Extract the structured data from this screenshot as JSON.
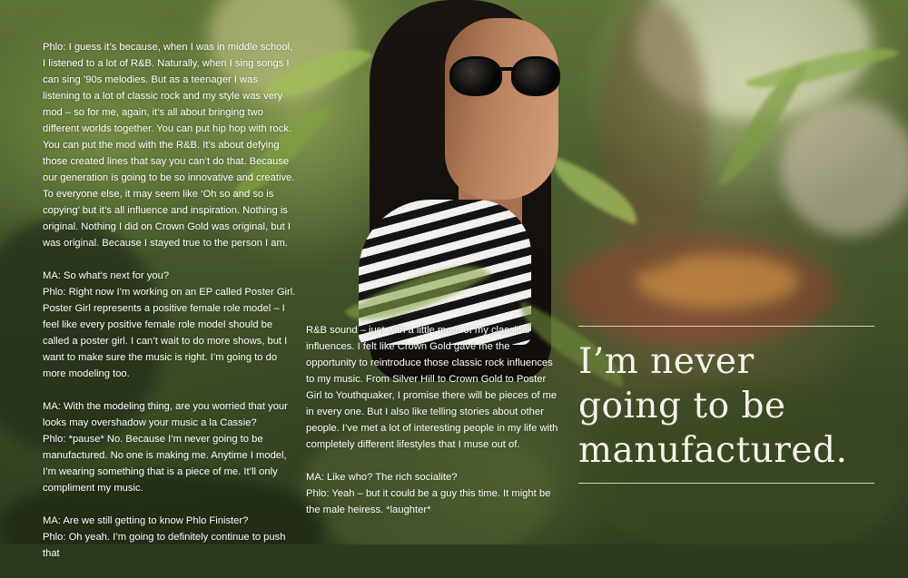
{
  "article": {
    "left_column": [
      "Phlo: I guess it’s because, when I was in middle school, I listened to a lot of R&B. Naturally, when I sing songs I can sing ’90s melodies. But as a teenager I was listening to a lot of classic rock and my style was very mod – so for me, again, it’s all about bringing two different worlds together. You can put hip hop with rock. You can put the mod with the R&B. It’s about defying those created lines that say you can’t do that. Because our generation is going to be so innovative and creative. To everyone else, it may seem like ‘Oh so and so is copying’ but it’s all influence and inspiration. Nothing is original. Nothing I did on Crown Gold was original, but I was original. Because I stayed true to the person I am.",
      "MA: So what’s next for you?\nPhlo: Right now I’m working on an EP called Poster Girl. Poster Girl represents a positive female role model – I feel like every positive female role model should be called a poster girl. I can’t wait to do more shows, but I want to make sure the music is right. I’m going to do more modeling too.",
      "MA: With the modeling thing, are you worried that your looks may overshadow your music a la Cassie?\nPhlo: *pause* No. Because I’m never going to be manufactured. No one is making me. Anytime I model, I’m wearing something that is a piece of me. It’ll only compliment my music.",
      "MA: Are we still getting to know Phlo Finister?\nPhlo: Oh yeah. I’m going to definitely continue to push that"
    ],
    "middle_column": [
      "R&B sound – just with a little more of my classical influences. I felt like Crown Gold gave me the opportunity to reintroduce those classic rock influences to my music. From Silver Hill to Crown Gold to Poster Girl to Youthquaker, I promise there will be pieces of me in every one. But I also like telling stories about other people. I’ve met a lot of interesting people in my life with completely different lifestyles that I muse out of.",
      "MA: Like who? The rich socialite?\nPhlo: Yeah – but it could be a guy this time. It might be the male heiress. *laughter*"
    ]
  },
  "pull_quote": {
    "lines": [
      "I’m never",
      "going to be",
      "manufactured."
    ]
  },
  "colors": {
    "text": "#ffffff",
    "quote": "#f6f3ea",
    "foliage_dark": "#2e3a1d",
    "foliage_light": "#8aa050"
  }
}
